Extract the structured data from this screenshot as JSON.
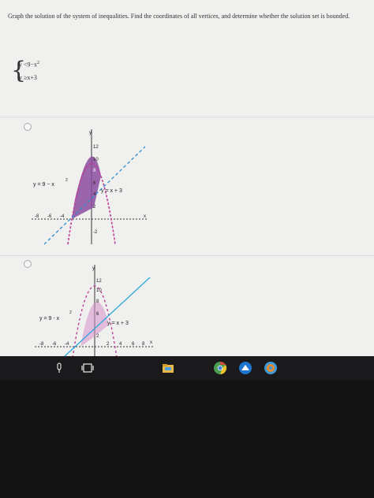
{
  "question": {
    "text": "Graph the solution of the system of inequalities. Find the coordinates of all vertices, and determine whether the solution set is bounded."
  },
  "system": {
    "line1": "y  <9−x",
    "line1_sup": "2",
    "line2": "y  ≥x+3"
  },
  "options": [
    {
      "parabola_label": "y = 9 − x",
      "parabola_sup": "2",
      "line_label": "y = x + 3",
      "y_axis_label": "y",
      "y_ticks": [
        "12",
        "10",
        "8",
        "6",
        "4",
        "2",
        "-2"
      ],
      "x_ticks": [
        "-8",
        "-6",
        "-4"
      ],
      "x_axis_label": "x",
      "shade_color": "#8b4c9e",
      "line_color": "#2f8fd0"
    },
    {
      "parabola_label": "y = 9 - x",
      "parabola_sup": "2",
      "line_label": "y = x + 3",
      "y_axis_label": "y",
      "y_ticks": [
        "12",
        "10",
        "8",
        "6",
        "2"
      ],
      "x_ticks": [
        "-8",
        "-6",
        "-4",
        "2",
        "4",
        "6",
        "8"
      ],
      "x_axis_label": "x",
      "shade_color": "#d58fc8",
      "line_color": "#2aa8e0"
    }
  ],
  "taskbar": {
    "icons": [
      "microphone-icon",
      "task-view-icon",
      "file-explorer-icon",
      "chrome-icon",
      "app-icon",
      "browser-icon"
    ]
  }
}
